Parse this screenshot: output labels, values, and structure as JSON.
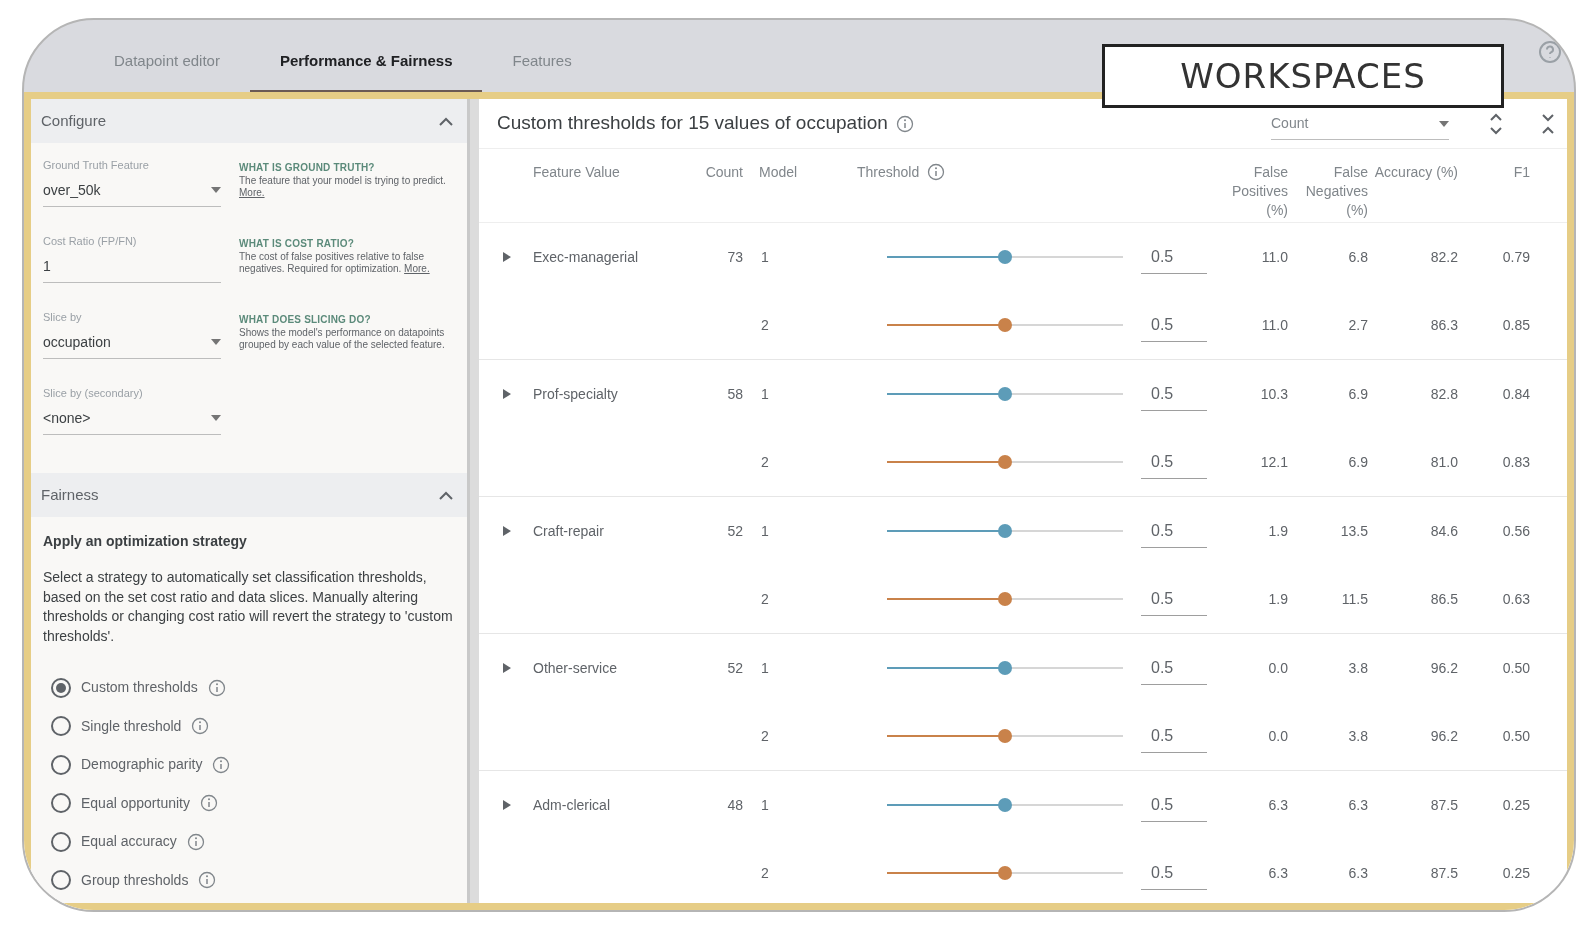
{
  "tabs": [
    {
      "label": "Datapoint editor",
      "selected": false
    },
    {
      "label": "Performance & Fairness",
      "selected": true
    },
    {
      "label": "Features",
      "selected": false
    }
  ],
  "overlay_caption": "WORKSPACES",
  "configure": {
    "title": "Configure",
    "expanded": true,
    "fields": [
      {
        "label": "Ground Truth Feature",
        "value": "over_50k",
        "kind": "select",
        "help_title": "WHAT IS GROUND TRUTH?",
        "help_text": "The feature that your model is trying to predict.",
        "help_link": "More."
      },
      {
        "label": "Cost Ratio (FP/FN)",
        "value": "1",
        "kind": "input",
        "help_title": "WHAT IS COST RATIO?",
        "help_text": "The cost of false positives relative to false negatives. Required for optimization.",
        "help_link": "More."
      },
      {
        "label": "Slice by",
        "value": "occupation",
        "kind": "select",
        "help_title": "WHAT DOES SLICING DO?",
        "help_text": "Shows the model's performance on datapoints grouped by each value of the selected feature."
      },
      {
        "label": "Slice by (secondary)",
        "value": "<none>",
        "kind": "select"
      }
    ]
  },
  "fairness": {
    "title": "Fairness",
    "expanded": true,
    "heading": "Apply an optimization strategy",
    "description": "Select a strategy to automatically set classification thresholds, based on the set cost ratio and data slices. Manually altering thresholds or changing cost ratio will revert the strategy to 'custom thresholds'.",
    "strategies": [
      {
        "label": "Custom thresholds",
        "selected": true
      },
      {
        "label": "Single threshold",
        "selected": false
      },
      {
        "label": "Demographic parity",
        "selected": false
      },
      {
        "label": "Equal opportunity",
        "selected": false
      },
      {
        "label": "Equal accuracy",
        "selected": false
      },
      {
        "label": "Group thresholds",
        "selected": false
      }
    ]
  },
  "thresholds": {
    "title": "Custom thresholds for 15 values of occupation",
    "sort": "Count",
    "columns": [
      "Feature Value",
      "Count",
      "Model",
      "Threshold",
      "False Positives (%)",
      "False Negatives (%)",
      "Accuracy (%)",
      "F1"
    ],
    "rows": [
      {
        "feature": "Exec-managerial",
        "count": "73",
        "expanded": false,
        "models": [
          {
            "model": "1",
            "color": "#5d9cb8",
            "level": 0.5,
            "threshold": "0.5",
            "fp": "11.0",
            "fn": "6.8",
            "accuracy": "82.2",
            "f1": "0.79"
          },
          {
            "model": "2",
            "color": "#c9824a",
            "level": 0.5,
            "threshold": "0.5",
            "fp": "11.0",
            "fn": "2.7",
            "accuracy": "86.3",
            "f1": "0.85"
          }
        ]
      },
      {
        "feature": "Prof-specialty",
        "count": "58",
        "expanded": false,
        "models": [
          {
            "model": "1",
            "color": "#5d9cb8",
            "level": 0.5,
            "threshold": "0.5",
            "fp": "10.3",
            "fn": "6.9",
            "accuracy": "82.8",
            "f1": "0.84"
          },
          {
            "model": "2",
            "color": "#c9824a",
            "level": 0.5,
            "threshold": "0.5",
            "fp": "12.1",
            "fn": "6.9",
            "accuracy": "81.0",
            "f1": "0.83"
          }
        ]
      },
      {
        "feature": "Craft-repair",
        "count": "52",
        "expanded": false,
        "models": [
          {
            "model": "1",
            "color": "#5d9cb8",
            "level": 0.5,
            "threshold": "0.5",
            "fp": "1.9",
            "fn": "13.5",
            "accuracy": "84.6",
            "f1": "0.56"
          },
          {
            "model": "2",
            "color": "#c9824a",
            "level": 0.5,
            "threshold": "0.5",
            "fp": "1.9",
            "fn": "11.5",
            "accuracy": "86.5",
            "f1": "0.63"
          }
        ]
      },
      {
        "feature": "Other-service",
        "count": "52",
        "expanded": false,
        "models": [
          {
            "model": "1",
            "color": "#5d9cb8",
            "level": 0.5,
            "threshold": "0.5",
            "fp": "0.0",
            "fn": "3.8",
            "accuracy": "96.2",
            "f1": "0.50"
          },
          {
            "model": "2",
            "color": "#c9824a",
            "level": 0.5,
            "threshold": "0.5",
            "fp": "0.0",
            "fn": "3.8",
            "accuracy": "96.2",
            "f1": "0.50"
          }
        ]
      },
      {
        "feature": "Adm-clerical",
        "count": "48",
        "expanded": false,
        "models": [
          {
            "model": "1",
            "color": "#5d9cb8",
            "level": 0.5,
            "threshold": "0.5",
            "fp": "6.3",
            "fn": "6.3",
            "accuracy": "87.5",
            "f1": "0.25"
          },
          {
            "model": "2",
            "color": "#c9824a",
            "level": 0.5,
            "threshold": "0.5",
            "fp": "6.3",
            "fn": "6.3",
            "accuracy": "87.5",
            "f1": "0.25"
          }
        ]
      }
    ]
  }
}
